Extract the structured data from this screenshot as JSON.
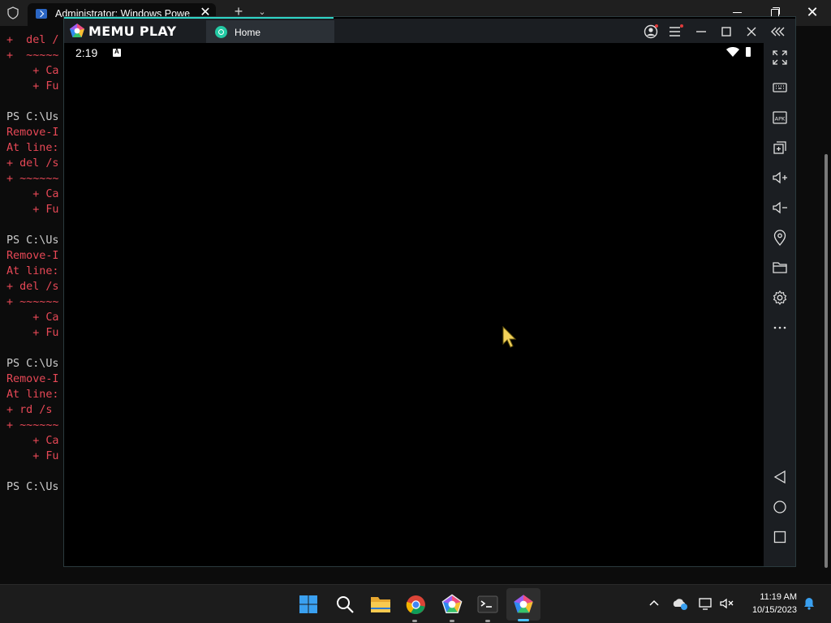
{
  "terminal": {
    "tab_title": "Administrator: Windows PowerShell",
    "new_tab_symbol": "+",
    "dropdown_symbol": "⌄",
    "close_symbol": "✕",
    "lines": [
      {
        "text": "+  del /",
        "style": "err"
      },
      {
        "text": "+  ~~~~~",
        "style": "err"
      },
      {
        "text": "    + Ca",
        "style": "err"
      },
      {
        "text": "    + Fu",
        "style": "err"
      },
      {
        "text": "",
        "style": "norm"
      },
      {
        "text": "PS C:\\Us",
        "style": "norm"
      },
      {
        "text": "Remove-I",
        "style": "err"
      },
      {
        "text": "At line:",
        "style": "err"
      },
      {
        "text": "+ del /s",
        "style": "err"
      },
      {
        "text": "+ ~~~~~~",
        "style": "err"
      },
      {
        "text": "    + Ca",
        "style": "err"
      },
      {
        "text": "    + Fu",
        "style": "err"
      },
      {
        "text": "",
        "style": "norm"
      },
      {
        "text": "PS C:\\Us",
        "style": "norm"
      },
      {
        "text": "Remove-I",
        "style": "err"
      },
      {
        "text": "At line:",
        "style": "err"
      },
      {
        "text": "+ del /s",
        "style": "err"
      },
      {
        "text": "+ ~~~~~~",
        "style": "err"
      },
      {
        "text": "    + Ca",
        "style": "err"
      },
      {
        "text": "    + Fu",
        "style": "err"
      },
      {
        "text": "",
        "style": "norm"
      },
      {
        "text": "PS C:\\Us",
        "style": "norm"
      },
      {
        "text": "Remove-I",
        "style": "err"
      },
      {
        "text": "At line:",
        "style": "err"
      },
      {
        "text": "+ rd /s ",
        "style": "err"
      },
      {
        "text": "+ ~~~~~~",
        "style": "err"
      },
      {
        "text": "    + Ca",
        "style": "err"
      },
      {
        "text": "    + Fu",
        "style": "err"
      },
      {
        "text": "",
        "style": "norm"
      },
      {
        "text": "PS C:\\Us",
        "style": "norm"
      }
    ]
  },
  "memu": {
    "logo_text": "MEMU PLAY",
    "tab_label": "Home",
    "status_time": "2:19",
    "accent_color": "#2fd6c6",
    "sidebar_tools": [
      "fullscreen-icon",
      "keyboard-icon",
      "apk-icon",
      "multi-instance-icon",
      "volume-up-icon",
      "volume-down-icon",
      "location-icon",
      "folder-icon",
      "settings-icon",
      "more-icon"
    ],
    "apk_label": "APK",
    "nav_buttons": [
      "back-icon",
      "home-icon",
      "recents-icon"
    ]
  },
  "taskbar": {
    "apps": [
      "start-button",
      "search-button",
      "file-explorer",
      "chrome",
      "memu-multi",
      "terminal",
      "memu-play"
    ],
    "clock_time": "11:19 AM",
    "clock_date": "10/15/2023"
  }
}
